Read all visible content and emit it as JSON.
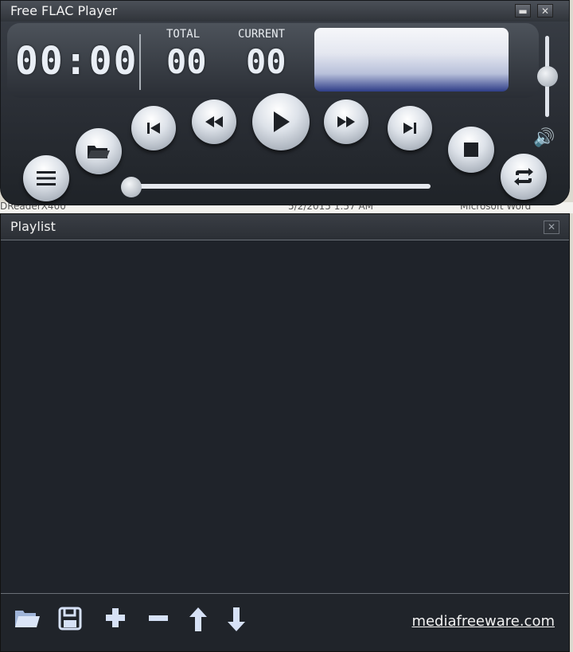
{
  "background": {
    "strip_texts": [
      "DReaderX400",
      "5/2/2015 1:57 AM",
      "Microsoft Word"
    ]
  },
  "player": {
    "title": "Free FLAC Player",
    "minimize_glyph": "▬",
    "close_glyph": "✕",
    "time": "00:00",
    "total_label": "TOTAL",
    "total_value": "00",
    "current_label": "CURRENT",
    "current_value": "00",
    "volume_level": 0.5,
    "seek_position": 0.0,
    "icons": {
      "menu": "menu-icon",
      "open": "folder-open-icon",
      "previous": "skip-previous-icon",
      "rewind": "rewind-icon",
      "play": "play-icon",
      "forward": "fast-forward-icon",
      "next": "skip-next-icon",
      "stop": "stop-icon",
      "repeat": "repeat-icon",
      "volume": "speaker-icon"
    }
  },
  "playlist": {
    "title": "Playlist",
    "close_glyph": "✕",
    "items": [],
    "toolbar": {
      "open_icon": "folder-icon",
      "save_icon": "save-icon",
      "add_icon": "plus-icon",
      "remove_icon": "minus-icon",
      "up_icon": "arrow-up-icon",
      "down_icon": "arrow-down-icon"
    },
    "site_link": "mediafreeware.com"
  },
  "colors": {
    "window_bg": "#2b2f36",
    "playlist_bg": "#1f232a",
    "accent_blue": "#2e3d88",
    "toolbar_icon": "#d6e1f6"
  }
}
